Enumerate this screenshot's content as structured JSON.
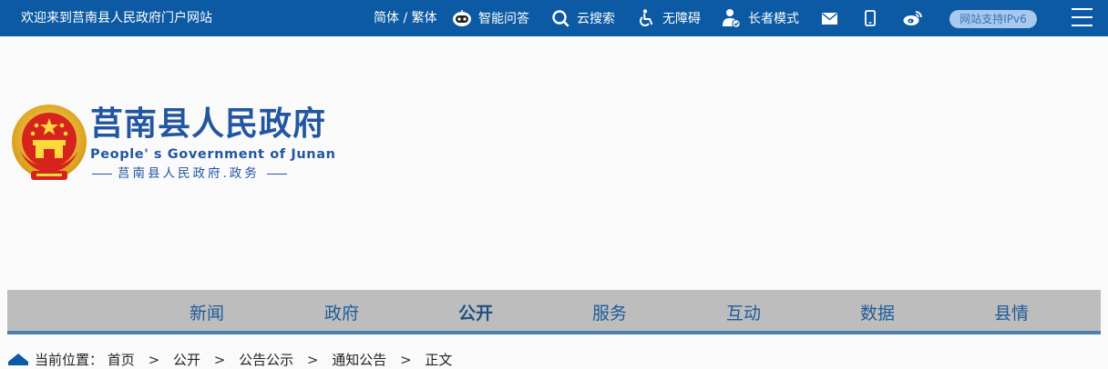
{
  "topbar": {
    "welcome": "欢迎来到莒南县人民政府门户网站",
    "lang_simplified": "简体",
    "lang_sep": " / ",
    "lang_traditional": "繁体",
    "ai_label": "智能问答",
    "search_label": "云搜索",
    "accessible_label": "无障碍",
    "elder_label": "长者模式",
    "ipv6_label": "网站支持IPv6",
    "bg_color": "#0b5aa3"
  },
  "logo": {
    "title": "莒南县人民政府",
    "subtitle_en": "People' s Government of Junan",
    "subtitle_cn": "莒南县人民政府.政务"
  },
  "nav": {
    "items": [
      {
        "label": "新闻"
      },
      {
        "label": "政府"
      },
      {
        "label": "公开",
        "active": true
      },
      {
        "label": "服务"
      },
      {
        "label": "互动"
      },
      {
        "label": "数据"
      },
      {
        "label": "县情"
      }
    ]
  },
  "breadcrumb": {
    "prefix": "当前位置：",
    "items": [
      "首页",
      "公开",
      "公告公示",
      "通知公告",
      "正文"
    ],
    "separator": ">"
  }
}
